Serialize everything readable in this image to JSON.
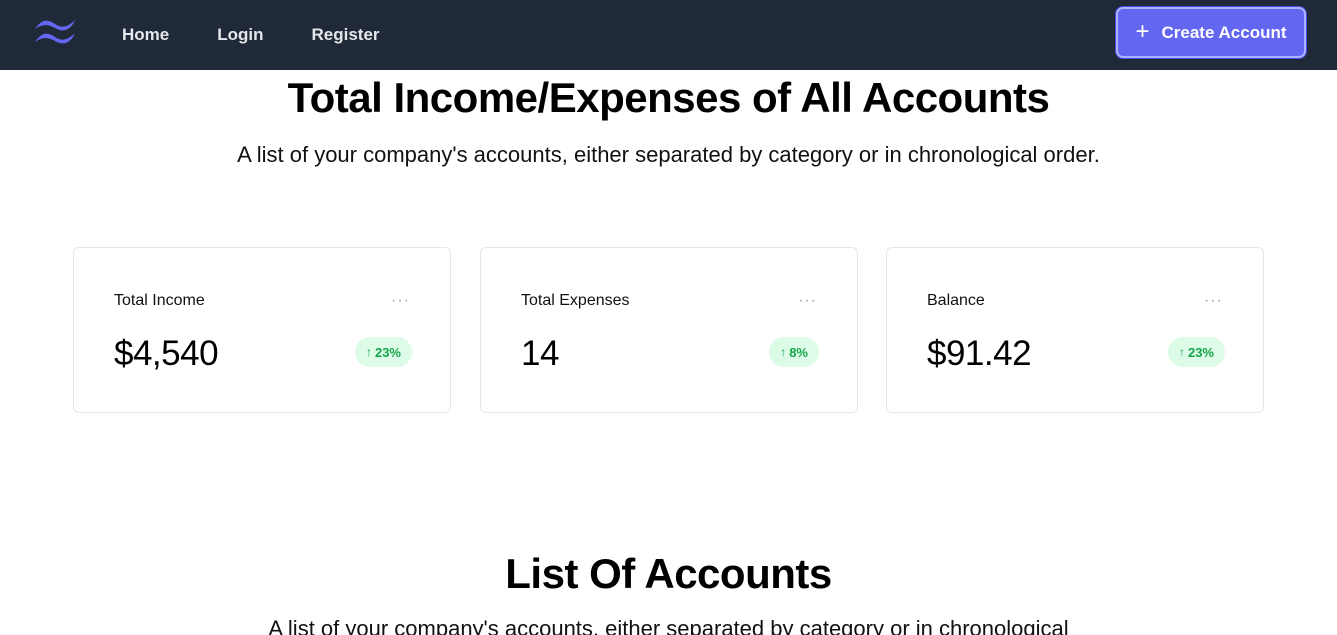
{
  "nav": {
    "links": [
      {
        "label": "Home"
      },
      {
        "label": "Login"
      },
      {
        "label": "Register"
      }
    ],
    "create_button": {
      "icon": "plus-icon",
      "label": "Create Account"
    }
  },
  "summary": {
    "title": "Total Income/Expenses of All Accounts",
    "subtitle": "A list of your company's accounts, either separated by category or in chronological order.",
    "cards": [
      {
        "label": "Total Income",
        "value": "$4,540",
        "change": "23%",
        "trend": "up"
      },
      {
        "label": "Total Expenses",
        "value": "14",
        "change": "8%",
        "trend": "up"
      },
      {
        "label": "Balance",
        "value": "$91.42",
        "change": "23%",
        "trend": "up"
      }
    ],
    "menu_glyph": "···",
    "arrow_glyph": "↑"
  },
  "accounts": {
    "title": "List Of Accounts",
    "subtitle": "A list of your company's accounts, either separated by category or in chronological"
  },
  "colors": {
    "navbar": "#1f2937",
    "accent": "#6366f1",
    "badge_bg": "#dcfce7",
    "badge_text": "#16a34a"
  }
}
